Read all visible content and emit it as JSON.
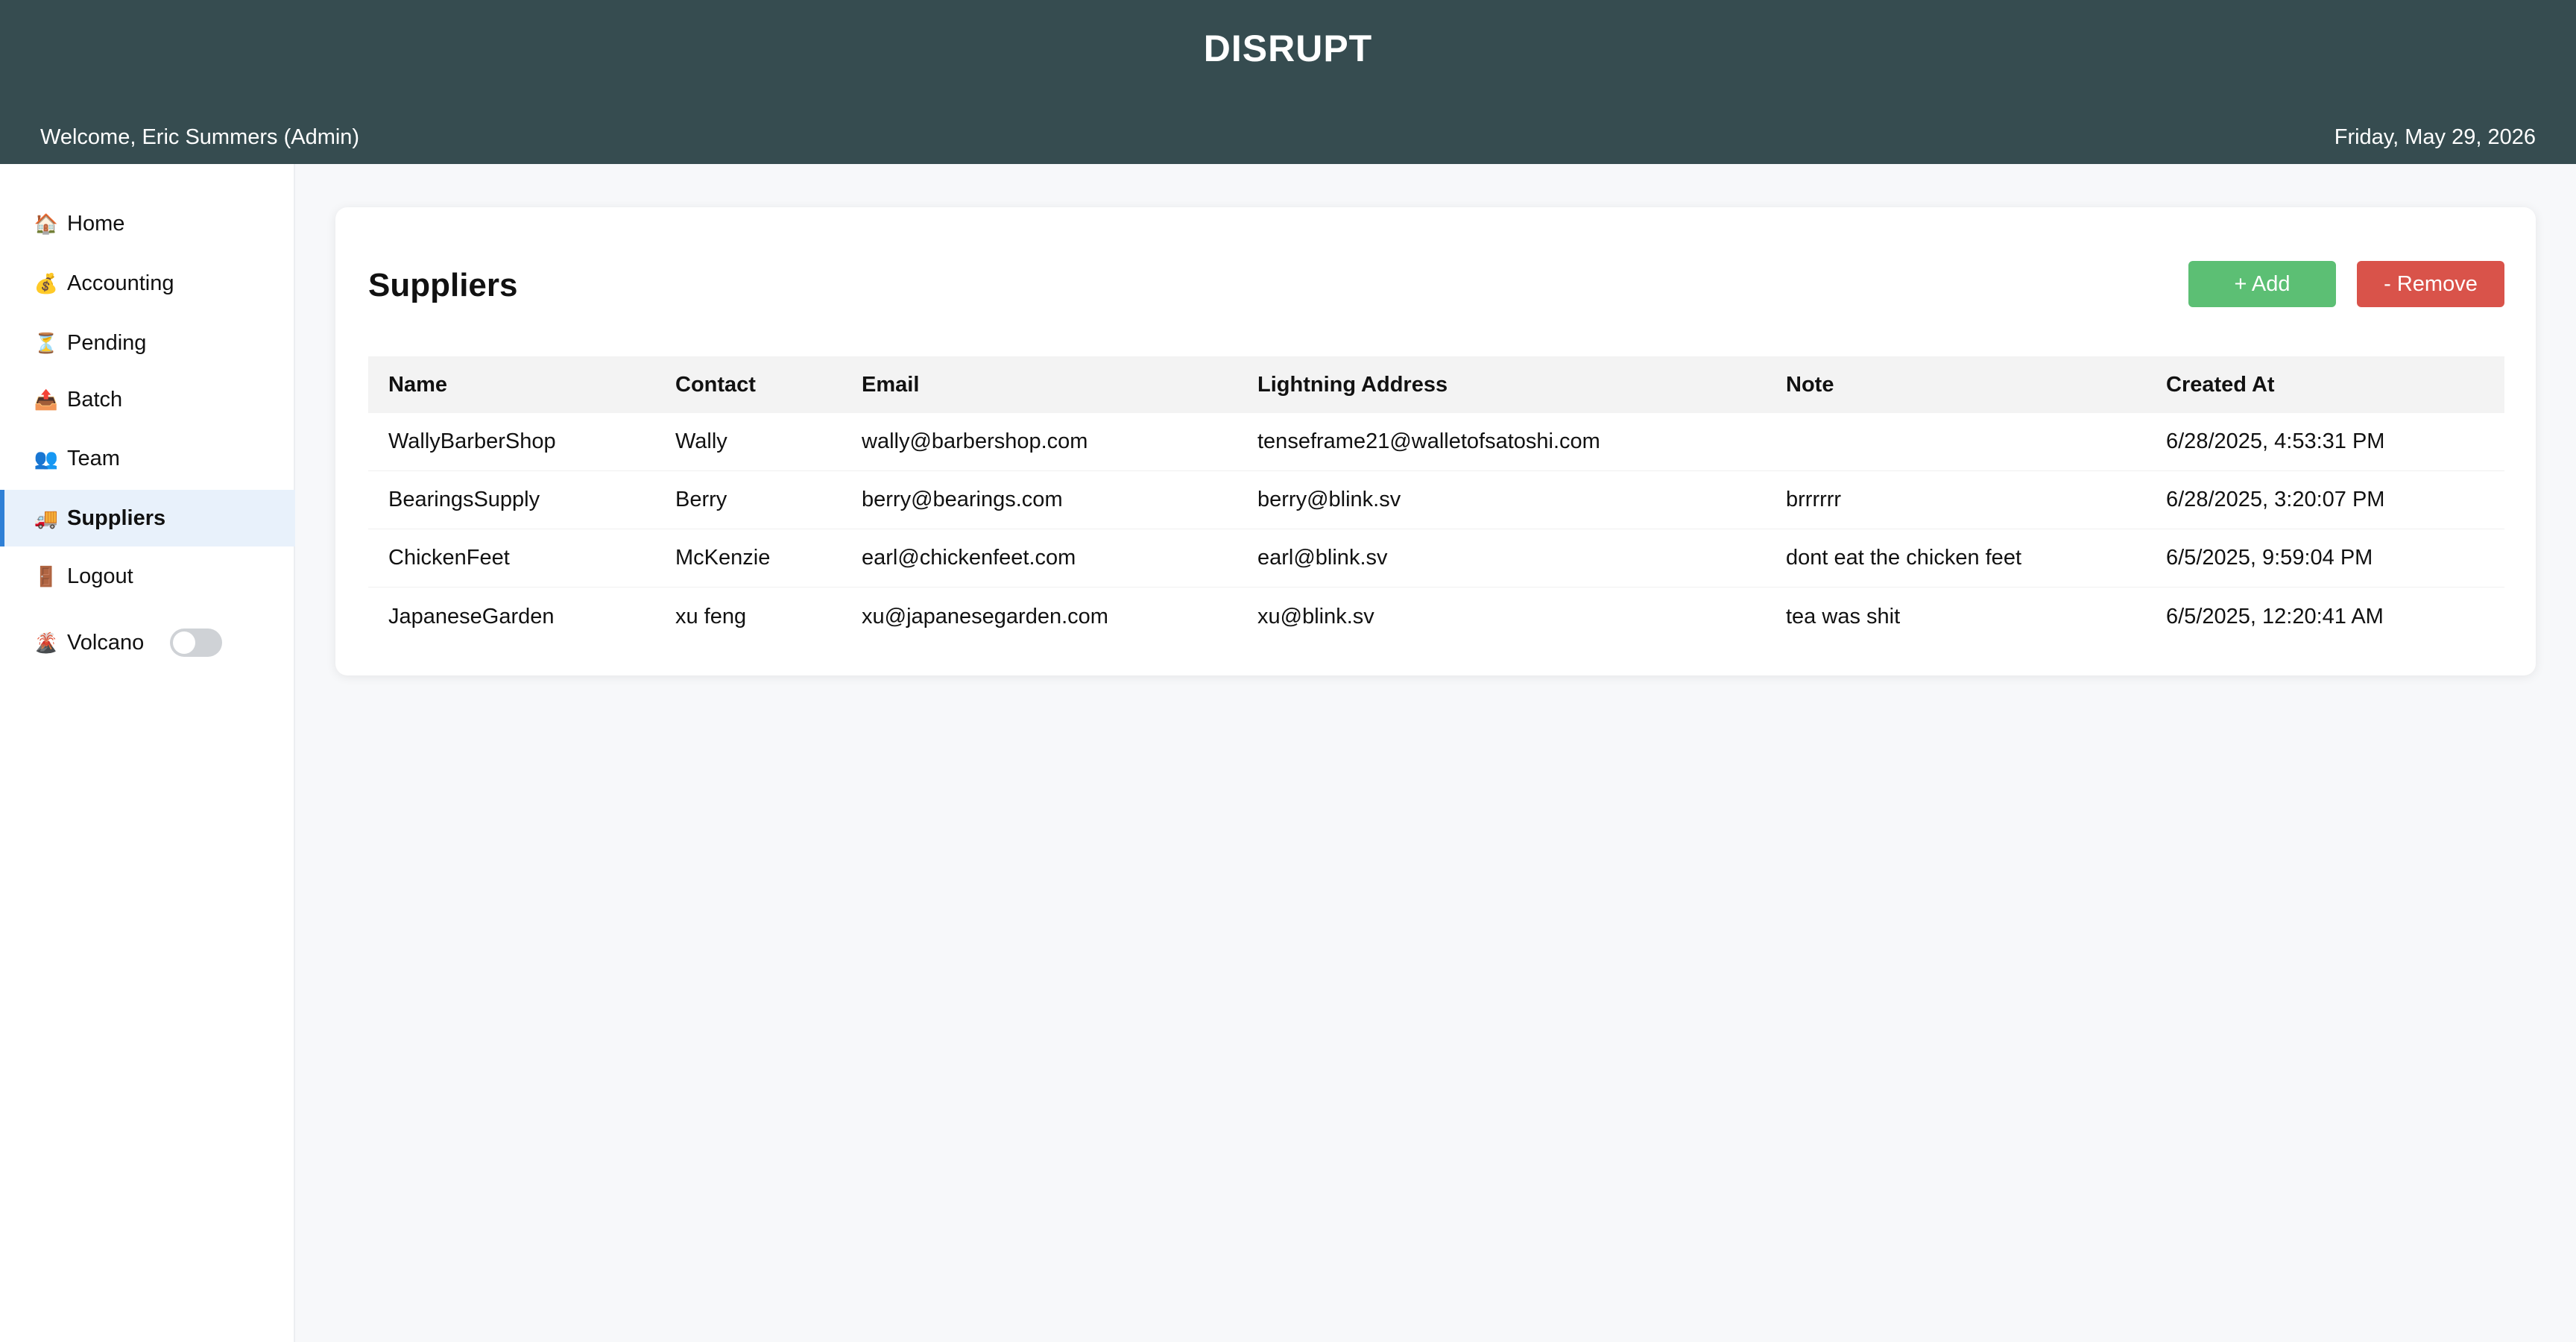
{
  "header": {
    "brand": "DISRUPT",
    "welcome": "Welcome, Eric Summers (Admin)",
    "date": "Friday, May 29, 2026",
    "background": "#364c50"
  },
  "sidebar": {
    "items": [
      {
        "icon": "🏠",
        "icon_name": "home-icon",
        "label": "Home"
      },
      {
        "icon": "💰",
        "icon_name": "money-bag-icon",
        "label": "Accounting"
      },
      {
        "icon": "⏳",
        "icon_name": "hourglass-icon",
        "label": "Pending"
      },
      {
        "icon": "📤",
        "icon_name": "upload-icon",
        "label": "Batch"
      },
      {
        "icon": "👥",
        "icon_name": "team-icon",
        "label": "Team"
      },
      {
        "icon": "🚚",
        "icon_name": "truck-icon",
        "label": "Suppliers",
        "active": true
      },
      {
        "icon": "🚪",
        "icon_name": "door-icon",
        "label": "Logout"
      },
      {
        "icon": "🌋",
        "icon_name": "volcano-icon",
        "label": "Volcano"
      }
    ],
    "volcano_toggle": "off",
    "active_color": "#2f80d6"
  },
  "main": {
    "title": "Suppliers",
    "add_label": "+ Add",
    "remove_label": "- Remove",
    "add_color": "#5cbf74",
    "remove_color": "#d9534a",
    "table": {
      "headers": [
        "Name",
        "Contact",
        "Email",
        "Lightning Address",
        "Note",
        "Created At"
      ],
      "rows": [
        [
          "WallyBarberShop",
          "Wally",
          "wally@barbershop.com",
          "tenseframe21@walletofsatoshi.com",
          "",
          "6/28/2025, 4:53:31 PM"
        ],
        [
          "BearingsSupply",
          "Berry",
          "berry@bearings.com",
          "berry@blink.sv",
          "brrrrrr",
          "6/28/2025, 3:20:07 PM"
        ],
        [
          "ChickenFeet",
          "McKenzie",
          "earl@chickenfeet.com",
          "earl@blink.sv",
          "dont eat the chicken feet",
          "6/5/2025, 9:59:04 PM"
        ],
        [
          "JapaneseGarden",
          "xu feng",
          "xu@japanesegarden.com",
          "xu@blink.sv",
          "tea was shit",
          "6/5/2025, 12:20:41 AM"
        ]
      ]
    }
  }
}
